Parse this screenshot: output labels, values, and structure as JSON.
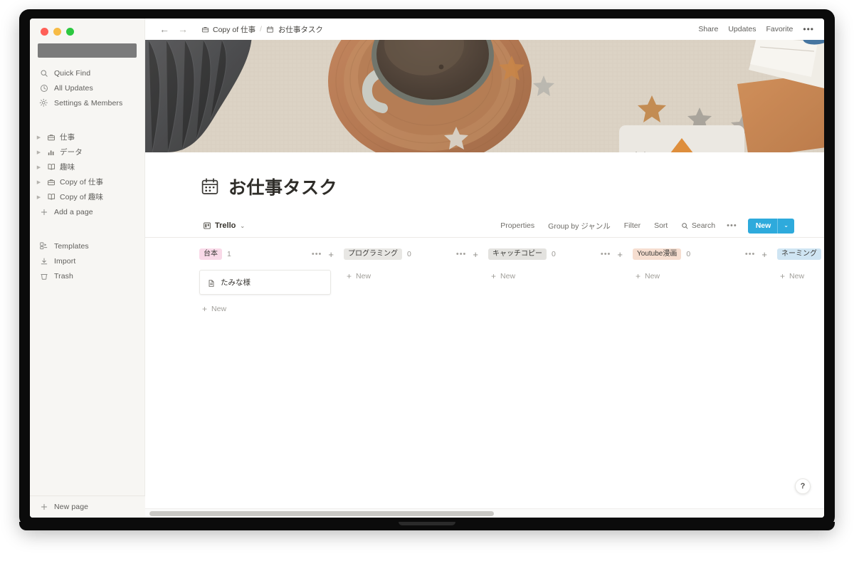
{
  "window": {
    "traffic_lights": [
      "close",
      "minimize",
      "maximize"
    ]
  },
  "sidebar": {
    "workspace_placeholder": "",
    "quick_items": [
      {
        "label": "Quick Find",
        "icon": "search-icon"
      },
      {
        "label": "All Updates",
        "icon": "clock-icon"
      },
      {
        "label": "Settings & Members",
        "icon": "gear-icon"
      }
    ],
    "pages": [
      {
        "label": "仕事",
        "icon": "briefcase-icon"
      },
      {
        "label": "データ",
        "icon": "chart-bar-icon"
      },
      {
        "label": "趣味",
        "icon": "book-icon"
      },
      {
        "label": "Copy of 仕事",
        "icon": "briefcase-icon"
      },
      {
        "label": "Copy of 趣味",
        "icon": "book-icon"
      }
    ],
    "add_page": {
      "label": "Add a page",
      "icon": "plus-icon"
    },
    "utility_items": [
      {
        "label": "Templates",
        "icon": "templates-icon"
      },
      {
        "label": "Import",
        "icon": "import-icon"
      },
      {
        "label": "Trash",
        "icon": "trash-icon"
      }
    ],
    "new_page": {
      "label": "New page",
      "icon": "plus-icon"
    }
  },
  "topbar": {
    "back": "←",
    "forward": "→",
    "breadcrumb": [
      {
        "label": "Copy of 仕事",
        "icon": "briefcase-icon"
      },
      {
        "label": "お仕事タスク",
        "icon": "calendar-icon"
      }
    ],
    "separator": "/",
    "actions": [
      "Share",
      "Updates",
      "Favorite"
    ],
    "more": "•••"
  },
  "page": {
    "icon": "calendar-icon",
    "title": "お仕事タスク"
  },
  "view": {
    "tab_label": "Trello",
    "tab_icon": "board-icon",
    "chevron": "⌄",
    "actions": {
      "properties": "Properties",
      "group_by": "Group by ジャンル",
      "filter": "Filter",
      "sort": "Sort",
      "search": "Search",
      "search_icon": "search-icon",
      "more": "•••"
    },
    "new_button": {
      "label": "New",
      "chevron": "⌄",
      "color": "#2eaadc"
    }
  },
  "board": {
    "new_label": "New",
    "columns": [
      {
        "name": "台本",
        "count": "1",
        "chip_bg": "#f9d9e8",
        "chip_fg": "#3b3a37",
        "cards": [
          {
            "title": "たみな様",
            "icon": "page-icon"
          }
        ]
      },
      {
        "name": "プログラミング",
        "count": "0",
        "chip_bg": "#e8e7e4",
        "chip_fg": "#3b3a37",
        "cards": []
      },
      {
        "name": "キャッチコピー",
        "count": "0",
        "chip_bg": "#e3e2df",
        "chip_fg": "#3b3a37",
        "cards": []
      },
      {
        "name": "Youtube漫画",
        "count": "0",
        "chip_bg": "#f6ded0",
        "chip_fg": "#3b3a37",
        "cards": []
      },
      {
        "name": "ネーミング",
        "count": "",
        "chip_bg": "#cfe5f3",
        "chip_fg": "#3b3a37",
        "cards": []
      }
    ]
  },
  "help": {
    "label": "?"
  },
  "scrollbar": {
    "orientation": "horizontal"
  }
}
